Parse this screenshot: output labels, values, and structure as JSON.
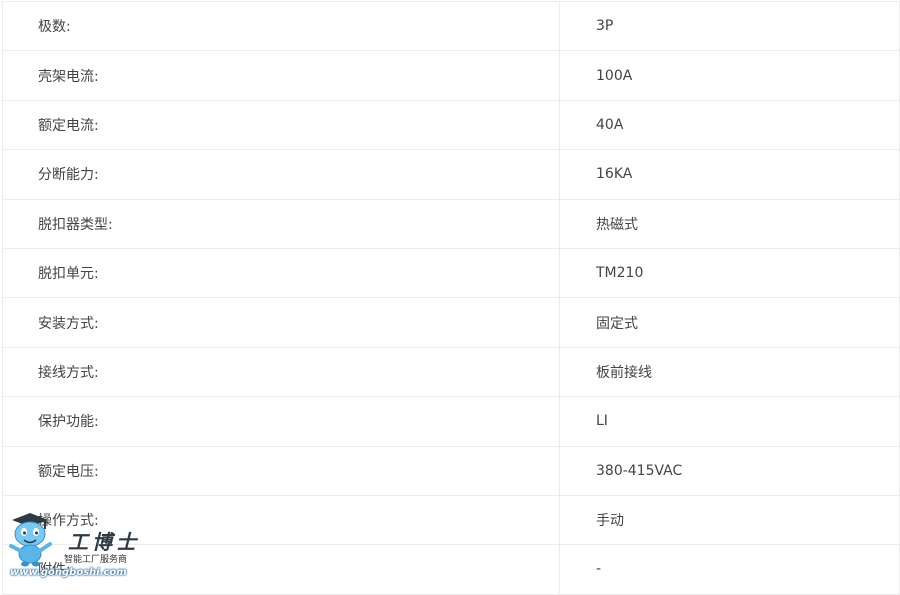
{
  "specs": [
    {
      "label": "极数:",
      "value": "3P"
    },
    {
      "label": "壳架电流:",
      "value": "100A"
    },
    {
      "label": "额定电流:",
      "value": "40A"
    },
    {
      "label": "分断能力:",
      "value": "16KA"
    },
    {
      "label": "脱扣器类型:",
      "value": "热磁式"
    },
    {
      "label": "脱扣单元:",
      "value": "TM210"
    },
    {
      "label": "安装方式:",
      "value": "固定式"
    },
    {
      "label": "接线方式:",
      "value": "板前接线"
    },
    {
      "label": "保护功能:",
      "value": "LI"
    },
    {
      "label": "额定电压:",
      "value": "380-415VAC"
    },
    {
      "label": "操作方式:",
      "value": "手动"
    },
    {
      "label": "附件:",
      "value": "-"
    }
  ],
  "watermark": {
    "brand": "工博士",
    "tagline": "智能工厂服务商",
    "url": "www.gongboshi.com",
    "colors": {
      "brand": "#2f3a47",
      "mascot": "#5bb5e6",
      "url_outline": "#2b6aa3"
    }
  }
}
